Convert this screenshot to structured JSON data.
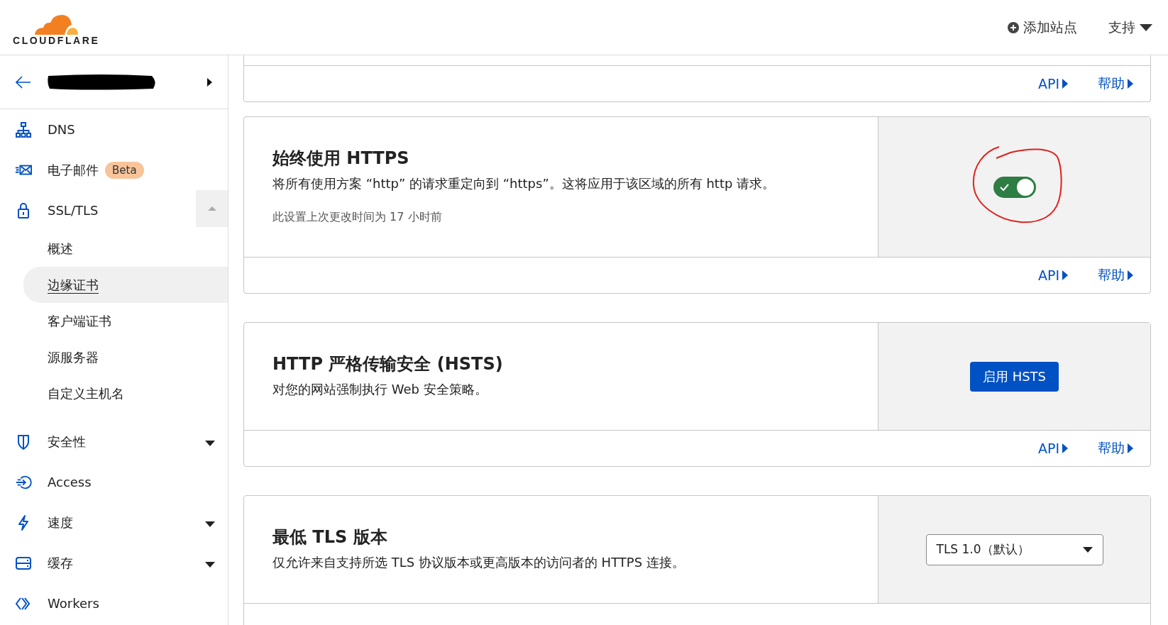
{
  "header": {
    "logo_text": "CLOUDFLARE",
    "actions": [
      {
        "kind": "add",
        "label": "添加站点"
      },
      {
        "kind": "menu",
        "label": "支持"
      }
    ]
  },
  "sidebar": {
    "site": {
      "redacted": true
    },
    "items": [
      {
        "kind": "sitemap",
        "label": "DNS"
      },
      {
        "kind": "mail",
        "label": "电子邮件",
        "badge": "Beta"
      },
      {
        "kind": "lock",
        "label": "SSL/TLS",
        "expanded": true,
        "children": [
          {
            "label": "概述",
            "selected": false
          },
          {
            "label": "边缘证书",
            "selected": true
          },
          {
            "label": "客户端证书",
            "selected": false
          },
          {
            "label": "源服务器",
            "selected": false
          },
          {
            "label": "自定义主机名",
            "selected": false
          }
        ]
      },
      {
        "kind": "shield",
        "label": "安全性",
        "expanded": false
      },
      {
        "kind": "access",
        "label": "Access"
      },
      {
        "kind": "bolt",
        "label": "速度",
        "expanded": false
      },
      {
        "kind": "storage",
        "label": "缓存",
        "expanded": false
      },
      {
        "kind": "code",
        "label": "Workers"
      }
    ]
  },
  "cards": [
    {
      "kind": "partial",
      "links": [
        "API",
        "帮助"
      ]
    },
    {
      "kind": "setting",
      "title": "始终使用 HTTPS",
      "description": "将所有使用方案 “http” 的请求重定向到 “https”。这将应用于该区域的所有 http 请求。",
      "meta": "此设置上次更改时间为 17 小时前",
      "control": {
        "kind": "toggle",
        "on": true,
        "circled": true
      },
      "links": [
        "API",
        "帮助"
      ]
    },
    {
      "kind": "setting",
      "title": "HTTP 严格传输安全 (HSTS)",
      "description": "对您的网站强制执行 Web 安全策略。",
      "control": {
        "kind": "button",
        "label": "启用 HSTS"
      },
      "links": [
        "API",
        "帮助"
      ]
    },
    {
      "kind": "setting",
      "title": "最低 TLS 版本",
      "description": "仅允许来自支持所选 TLS 协议版本或更高版本的访问者的 HTTPS 连接。",
      "control": {
        "kind": "select",
        "value": "TLS 1.0（默认）"
      }
    }
  ]
}
